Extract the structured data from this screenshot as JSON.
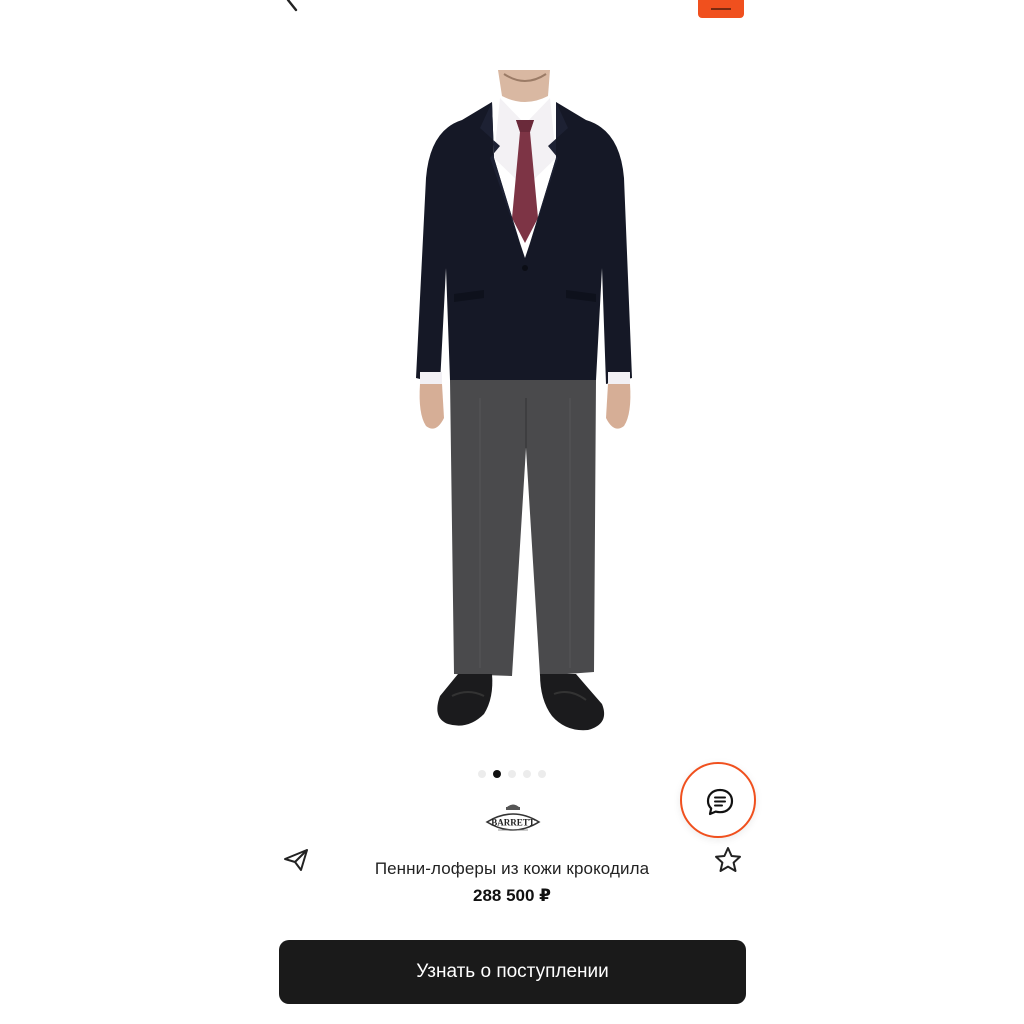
{
  "header": {
    "back_icon": "chevron-left-icon",
    "badge_icon": "promo-badge-icon",
    "badge_color": "#f0501e"
  },
  "gallery": {
    "image": "man-in-black-blazer-grey-trousers-loafers",
    "slides_count": 5,
    "active_slide": 2
  },
  "product": {
    "brand_logo_text": "BARRETT",
    "title": "Пенни-лоферы из кожи крокодила",
    "price": "288 500 ₽"
  },
  "actions": {
    "share_icon": "paper-plane-icon",
    "favorite_icon": "star-outline-icon",
    "chat_icon": "chat-bubble-icon",
    "chat_accent": "#f0501e",
    "notify_button_label": "Узнать о поступлении",
    "notify_button_color": "#1a1a1a"
  }
}
